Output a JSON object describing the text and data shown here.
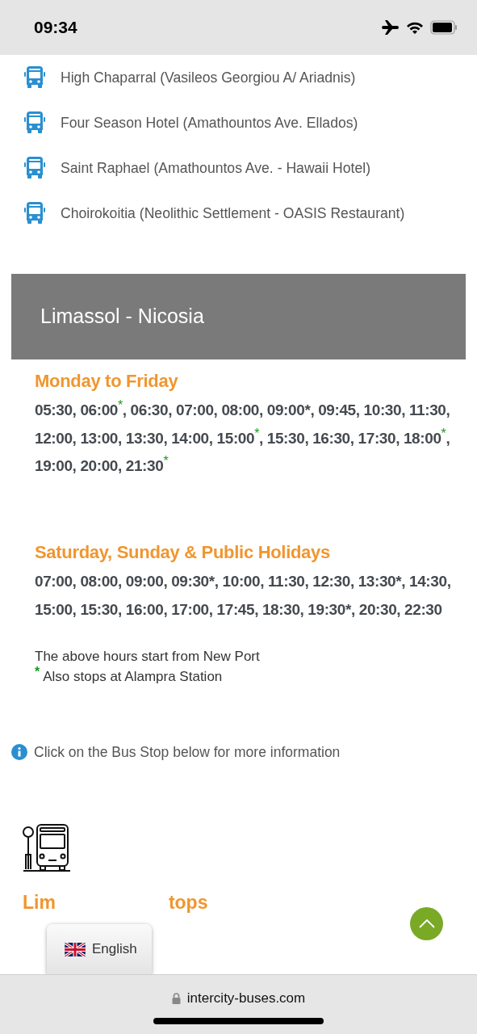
{
  "status_bar": {
    "time": "09:34"
  },
  "stops": [
    {
      "name": "High Chaparral (Vasileos Georgiou A/ Ariadnis)"
    },
    {
      "name": "Four Season Hotel (Amathountos Ave. Ellados)"
    },
    {
      "name": "Saint Raphael (Amathountos Ave. - Hawaii Hotel)"
    },
    {
      "name": "Choirokoitia (Neolithic Settlement - OASIS Restaurant)"
    }
  ],
  "route": {
    "title": "Limassol - Nicosia",
    "schedules": [
      {
        "title": "Monday to Friday",
        "times": [
          {
            "time": "05:30",
            "sep": ","
          },
          {
            "time": "06:00",
            "footnote": "*",
            "sep": ","
          },
          {
            "time": "06:30",
            "sep": ","
          },
          {
            "time": "07:00",
            "sep": ","
          },
          {
            "time": "08:00",
            "sep": ","
          },
          {
            "time": "09:00*",
            "sep": ","
          },
          {
            "time": "09:45",
            "sep": ","
          },
          {
            "time": "10:30",
            "sep": ","
          },
          {
            "time": "11:30",
            "sep": ","
          },
          {
            "time": "12:00",
            "sep": ","
          },
          {
            "time": "13:00",
            "sep": ","
          },
          {
            "time": "13:30",
            "sep": ","
          },
          {
            "time": "14:00",
            "sep": ","
          },
          {
            "time": "15:00",
            "footnote": "*",
            "sep": ","
          },
          {
            "time": "15:30",
            "sep": ","
          },
          {
            "time": "16:30",
            "sep": ","
          },
          {
            "time": "17:30",
            "sep": ","
          },
          {
            "time": "18:00",
            "footnote": "*",
            "sep": ","
          },
          {
            "time": "19:00",
            "sep": ","
          },
          {
            "time": "20:00",
            "sep": ","
          },
          {
            "time": "21:30",
            "footnote": "*"
          }
        ]
      },
      {
        "title": "Saturday, Sunday & Public Holidays",
        "times": [
          {
            "time": "07:00",
            "sep": ","
          },
          {
            "time": "08:00",
            "sep": ","
          },
          {
            "time": "09:00",
            "sep": ","
          },
          {
            "time": "09:30*",
            "sep": ","
          },
          {
            "time": "10:00",
            "sep": ","
          },
          {
            "time": "11:30",
            "sep": ","
          },
          {
            "time": "12:30",
            "sep": ","
          },
          {
            "time": "13:30*",
            "sep": ","
          },
          {
            "time": "14:30",
            "sep": ","
          },
          {
            "time": "15:00",
            "sep": ","
          },
          {
            "time": "15:30",
            "sep": ","
          },
          {
            "time": "16:00",
            "sep": ","
          },
          {
            "time": "17:00",
            "sep": ","
          },
          {
            "time": "17:45",
            "sep": ","
          },
          {
            "time": "18:30",
            "sep": ","
          },
          {
            "time": "19:30*",
            "sep": ","
          },
          {
            "time": "20:30",
            "sep": ","
          },
          {
            "time": "22:30"
          }
        ]
      }
    ],
    "notes": [
      {
        "text": "The above hours start from New Port"
      },
      {
        "footnote": "*",
        "text": "Also stops at Alampra Station"
      }
    ]
  },
  "info": "Click on the Bus Stop below for more information",
  "stops_heading": {
    "visible_start": "Lim",
    "visible_end": "tops"
  },
  "language": {
    "label": "English"
  },
  "browser": {
    "url": "intercity-buses.com"
  }
}
